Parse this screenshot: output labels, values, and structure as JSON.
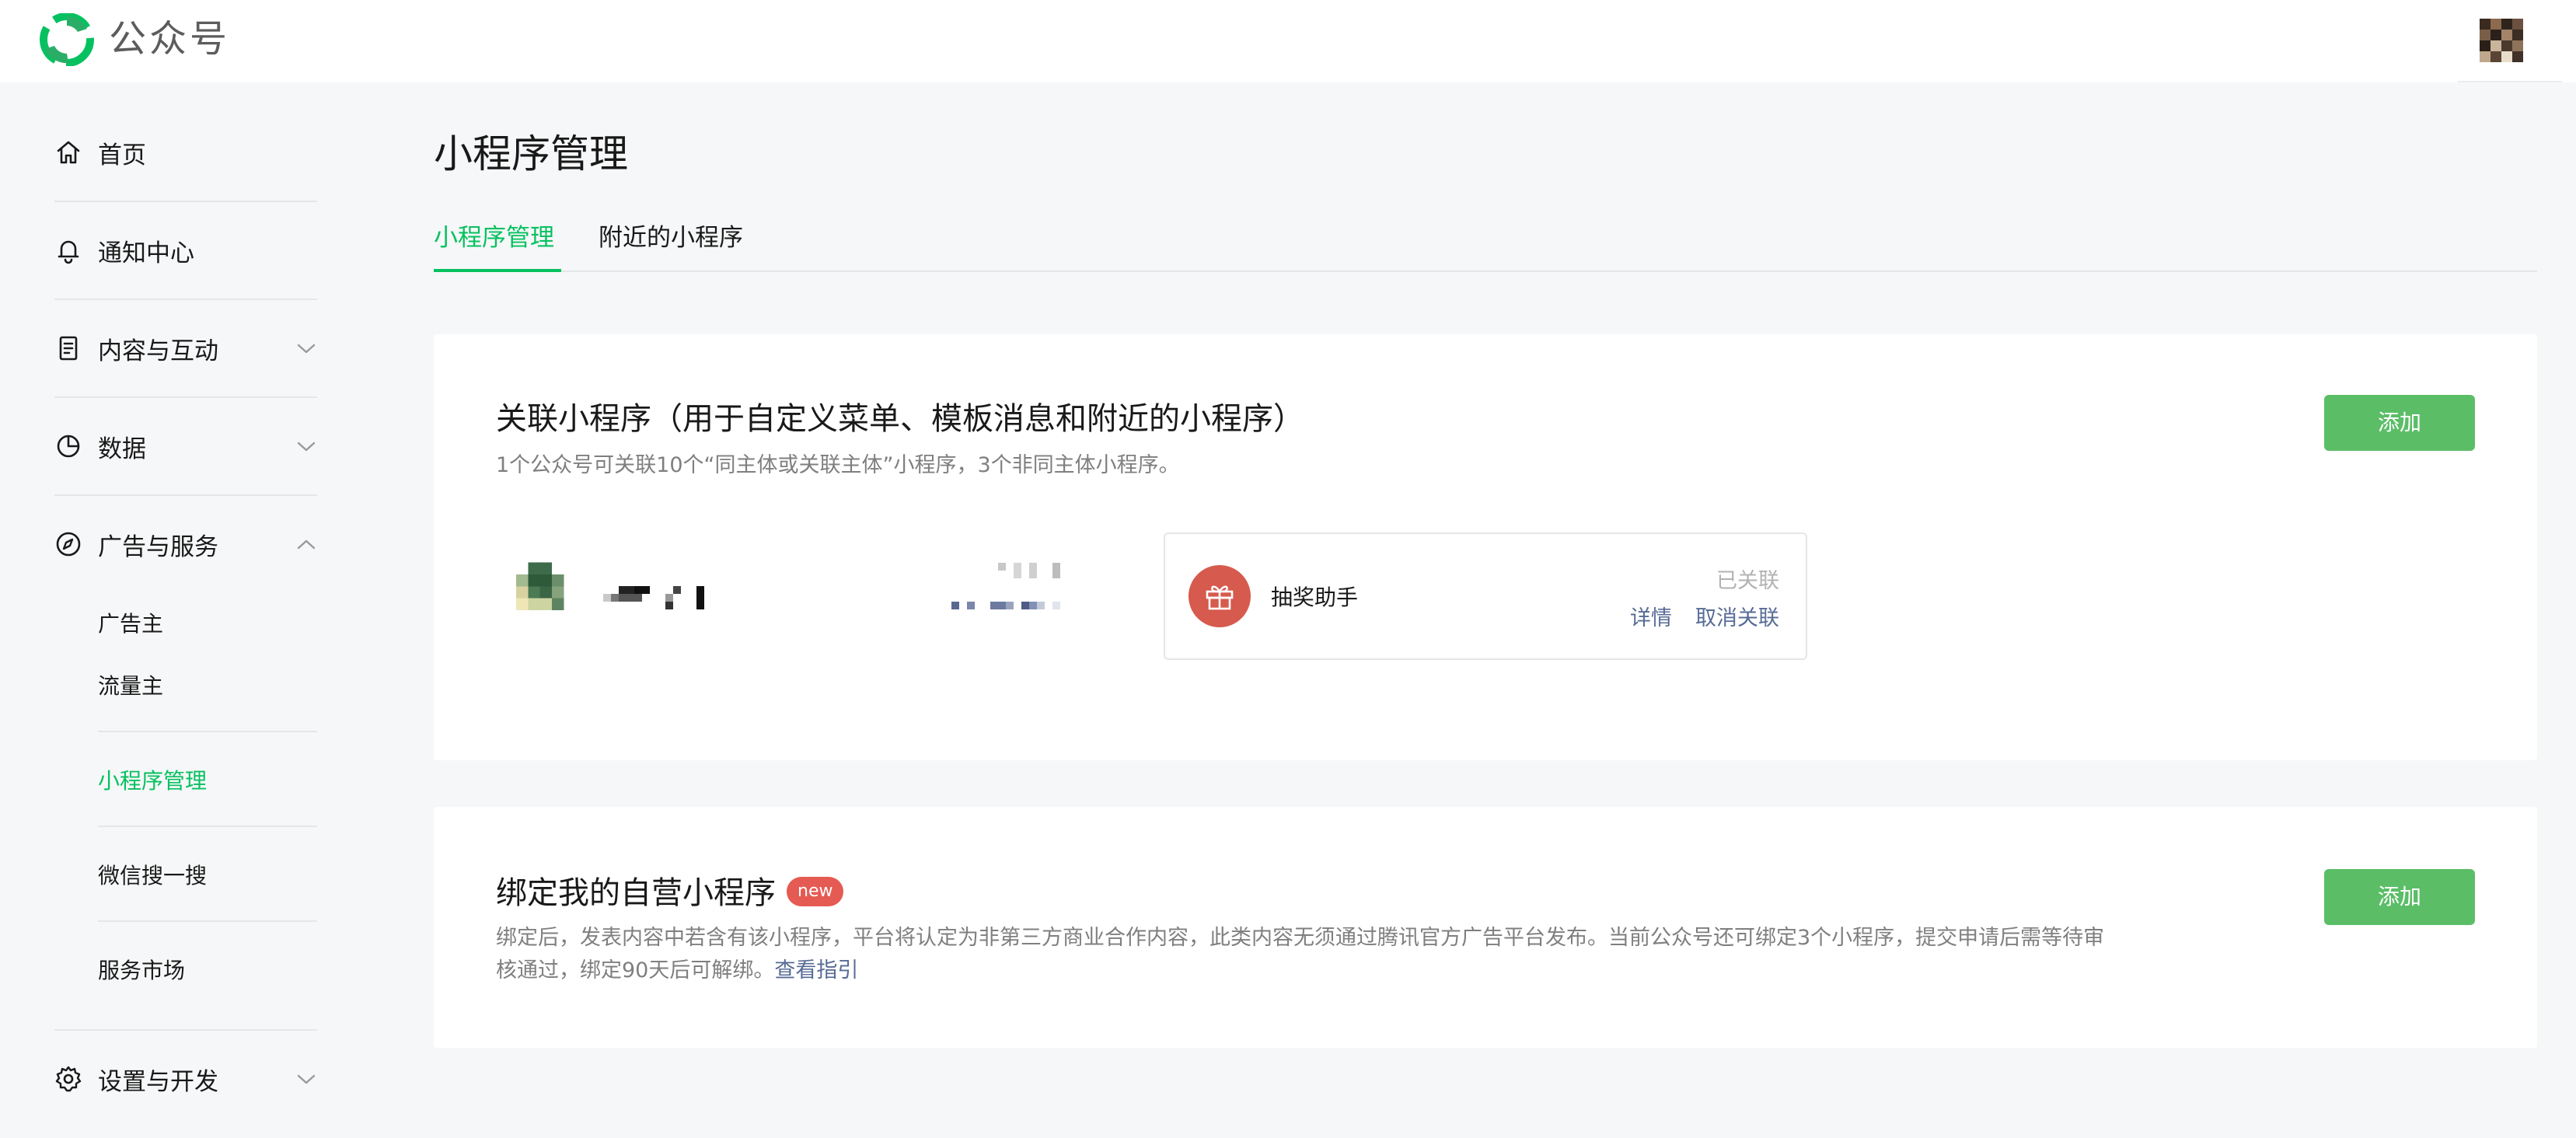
{
  "header": {
    "brand": "公众号",
    "brand_color": "#07c160"
  },
  "sidebar": {
    "items": [
      {
        "label": "首页",
        "icon": "home-icon"
      },
      {
        "label": "通知中心",
        "icon": "bell-icon"
      },
      {
        "label": "内容与互动",
        "icon": "document-icon",
        "expandable": true,
        "expanded": false
      },
      {
        "label": "数据",
        "icon": "pie-chart-icon",
        "expandable": true,
        "expanded": false
      },
      {
        "label": "广告与服务",
        "icon": "compass-icon",
        "expandable": true,
        "expanded": true
      },
      {
        "label": "设置与开发",
        "icon": "gear-icon",
        "expandable": true,
        "expanded": false
      }
    ],
    "sub_items": [
      {
        "label": "广告主",
        "active": false
      },
      {
        "label": "流量主",
        "active": false
      },
      {
        "label": "小程序管理",
        "active": true
      },
      {
        "label": "微信搜一搜",
        "active": false
      },
      {
        "label": "服务市场",
        "active": false
      }
    ]
  },
  "main": {
    "title": "小程序管理",
    "tabs": [
      {
        "label": "小程序管理",
        "active": true
      },
      {
        "label": "附近的小程序",
        "active": false
      }
    ],
    "linked_section": {
      "title": "关联小程序（用于自定义菜单、模板消息和附近的小程序）",
      "description": "1个公众号可关联10个“同主体或关联主体”小程序，3个非同主体小程序。",
      "add_label": "添加",
      "items": [
        {
          "name": "抽奖助手",
          "icon": "gift-icon",
          "status": "已关联",
          "detail_label": "详情",
          "unlink_label": "取消关联"
        }
      ]
    },
    "bind_section": {
      "title": "绑定我的自营小程序",
      "badge": "new",
      "description_line1": "绑定后，发表内容中若含有该小程序，平台将认定为非第三方商业合作内容，此类内容无须通过腾讯官方广告平台发布。当前公众号还可绑定3个小程序，提交申请后需等待审",
      "description_line2": "核通过，绑定90天后可解绑。",
      "guide_link": "查看指引",
      "add_label": "添加"
    }
  },
  "colors": {
    "accent": "#07c160",
    "button": "#5bbe67",
    "link": "#576b95",
    "badge": "#e55a52"
  }
}
